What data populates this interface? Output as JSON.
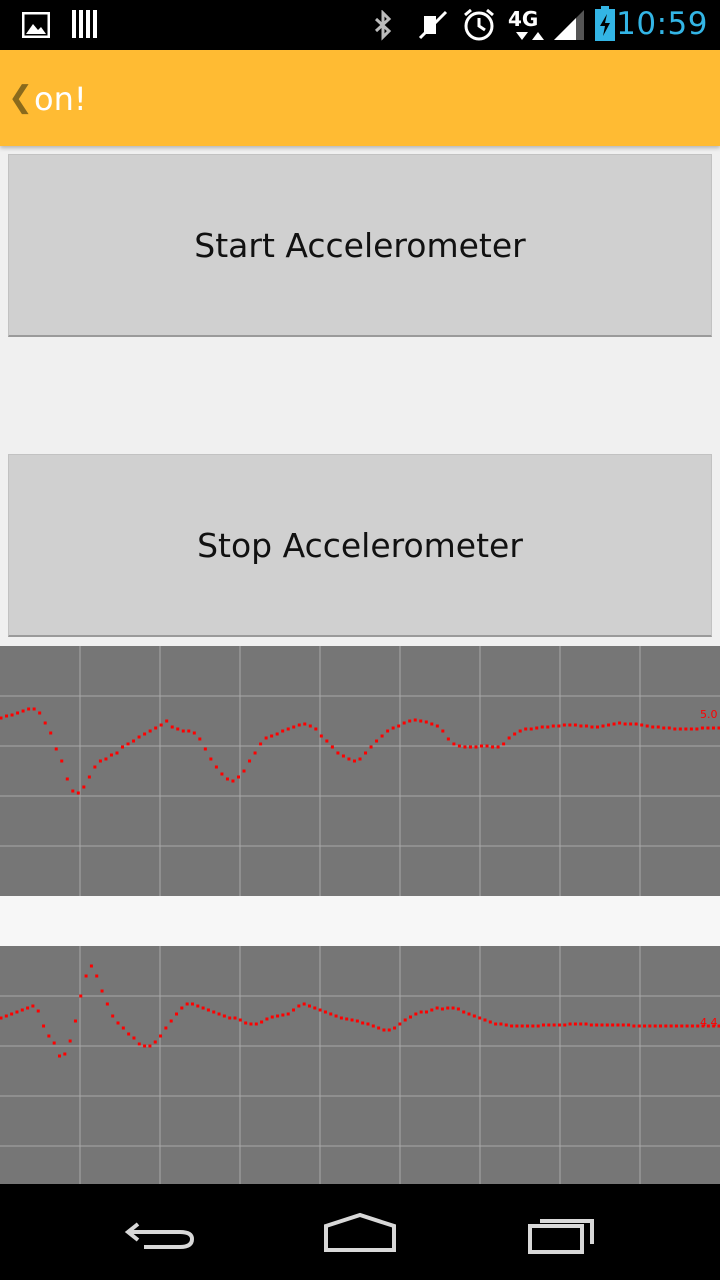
{
  "status_bar": {
    "time": "10:59",
    "icons": [
      "gallery-icon",
      "barcode-icon",
      "bluetooth-icon",
      "mute-icon",
      "alarm-icon",
      "lte-4g-icon",
      "signal-icon",
      "battery-charging-icon"
    ],
    "network": "4G"
  },
  "action_bar": {
    "up_icon": "chevron-left-icon",
    "title": "on!"
  },
  "buttons": {
    "start_label": "Start Accelerometer",
    "stop_label": "Stop Accelerometer"
  },
  "graphs": [
    {
      "label": "5.0",
      "color": "#ff0000",
      "grid_color": "#a8a8a8",
      "y_series": [
        17,
        15,
        14,
        12,
        10,
        8,
        8,
        12,
        22,
        32,
        48,
        60,
        78,
        90,
        92,
        86,
        76,
        66,
        60,
        58,
        54,
        52,
        46,
        43,
        40,
        36,
        33,
        30,
        27,
        24,
        20,
        26,
        28,
        30,
        30,
        32,
        38,
        48,
        58,
        66,
        73,
        78,
        80,
        76,
        70,
        60,
        52,
        43,
        37,
        35,
        33,
        30,
        28,
        26,
        24,
        23,
        25,
        28,
        35,
        40,
        46,
        52,
        55,
        58,
        60,
        58,
        52,
        46,
        40,
        35,
        30,
        27,
        25,
        22,
        20,
        19,
        20,
        21,
        23,
        25,
        30,
        38,
        43,
        45,
        46,
        46,
        46,
        45,
        45,
        46,
        46,
        43,
        37,
        33,
        30,
        28,
        28,
        27,
        26,
        26,
        25,
        25,
        24,
        24,
        24,
        25,
        25,
        26,
        26,
        25,
        24,
        23,
        22,
        23,
        23,
        23,
        24,
        25,
        26,
        26,
        27,
        27,
        28,
        28,
        28,
        28,
        28,
        27,
        27,
        27,
        27
      ]
    },
    {
      "label": "4.4",
      "color": "#ff0000",
      "grid_color": "#a8a8a8",
      "y_series": [
        72,
        70,
        68,
        66,
        64,
        62,
        60,
        65,
        80,
        90,
        97,
        110,
        108,
        95,
        75,
        50,
        30,
        20,
        30,
        45,
        58,
        70,
        77,
        82,
        88,
        92,
        98,
        100,
        100,
        96,
        90,
        82,
        75,
        68,
        62,
        58,
        58,
        60,
        62,
        64,
        66,
        68,
        70,
        72,
        72,
        74,
        77,
        78,
        78,
        76,
        73,
        71,
        70,
        69,
        68,
        64,
        60,
        58,
        60,
        62,
        64,
        66,
        68,
        70,
        72,
        73,
        74,
        75,
        77,
        78,
        80,
        82,
        84,
        84,
        82,
        78,
        74,
        71,
        68,
        66,
        66,
        64,
        62,
        63,
        62,
        62,
        63,
        66,
        68,
        70,
        72,
        74,
        76,
        78,
        78,
        79,
        80,
        80,
        80,
        80,
        80,
        80,
        79,
        79,
        79,
        79,
        79,
        78,
        78,
        78,
        78,
        79,
        79,
        79,
        79,
        79,
        79,
        79,
        79,
        80,
        80,
        80,
        80,
        80,
        80,
        80,
        80,
        80,
        80,
        80,
        80,
        80,
        80,
        80,
        80,
        80
      ]
    }
  ]
}
